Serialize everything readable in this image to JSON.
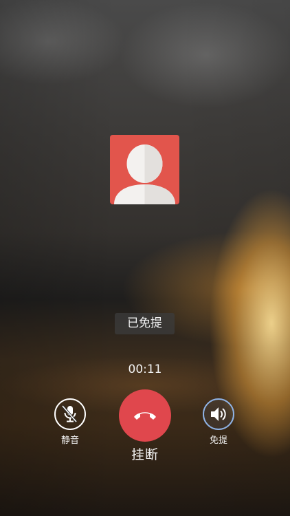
{
  "call": {
    "status_toast": "已免提",
    "timer": "00:11"
  },
  "controls": {
    "mute_label": "静音",
    "hangup_label": "挂断",
    "speaker_label": "免提"
  },
  "icons": {
    "avatar": "default-contact-avatar-icon",
    "mute": "microphone-muted-icon",
    "hangup": "phone-hangup-icon",
    "speaker": "speaker-icon"
  },
  "colors": {
    "avatar_bg": "#e2554c",
    "hangup_bg": "#e0474d",
    "speaker_active": "#8fb3e6"
  }
}
